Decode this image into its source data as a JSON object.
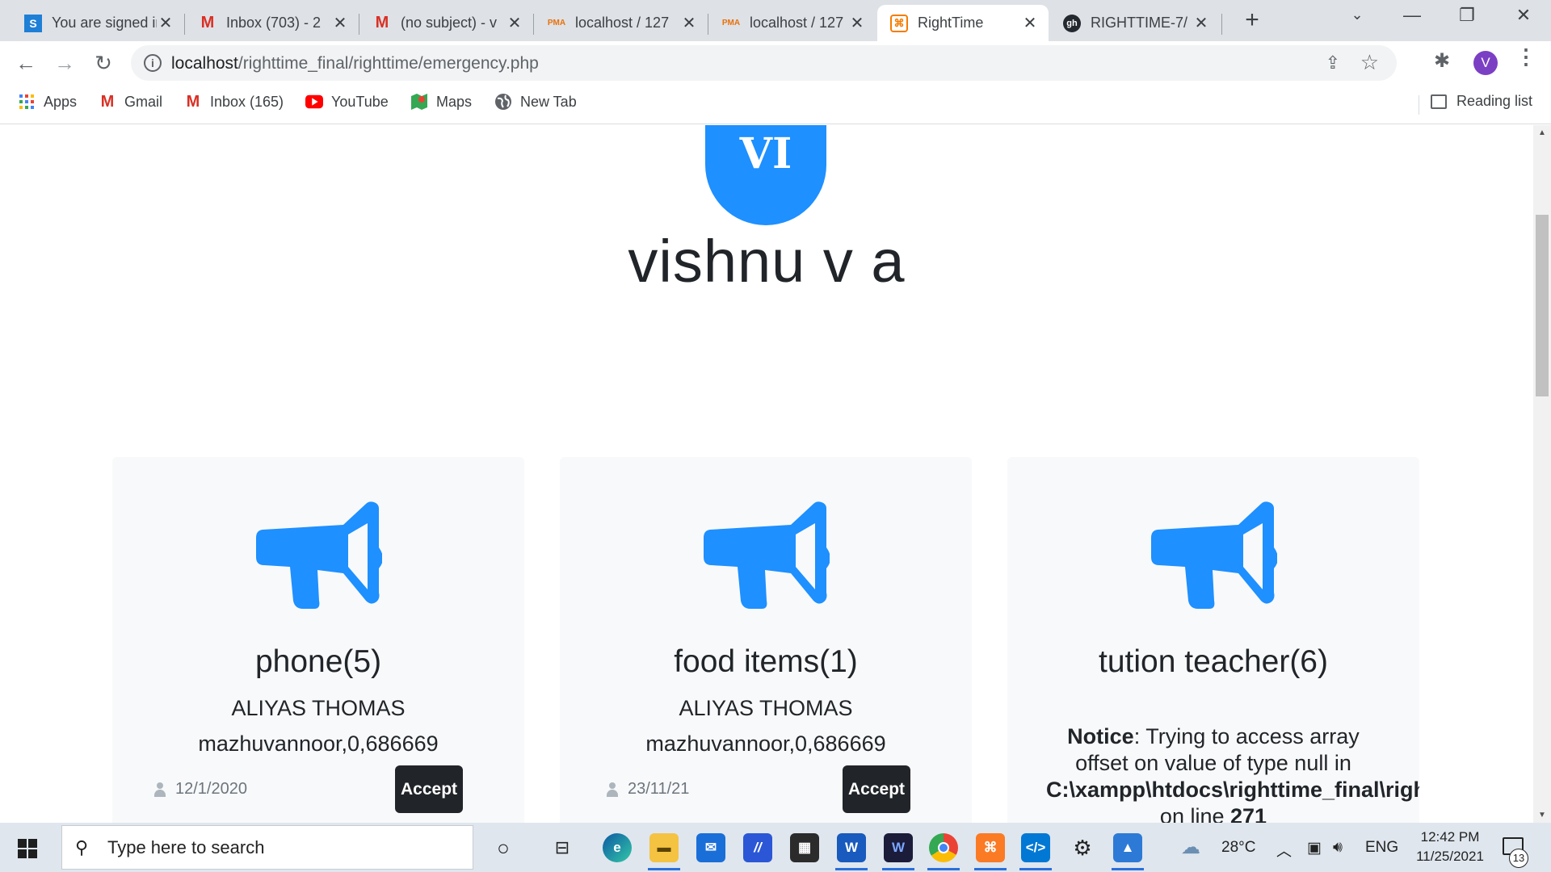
{
  "browser": {
    "tabs": [
      {
        "title": "You are signed in",
        "favicon": "S",
        "color": "#1e7fd6",
        "active": false
      },
      {
        "title": "Inbox (703) - 2",
        "favicon": "M",
        "color": "#d93025",
        "active": false
      },
      {
        "title": "(no subject) - v",
        "favicon": "M",
        "color": "#d93025",
        "active": false
      },
      {
        "title": "localhost / 127",
        "favicon": "PMA",
        "color": "#e8710a",
        "active": false
      },
      {
        "title": "localhost / 127",
        "favicon": "PMA",
        "color": "#e8710a",
        "active": false
      },
      {
        "title": "RightTime",
        "favicon": "x",
        "color": "#f57c00",
        "active": true
      },
      {
        "title": "RIGHTTIME-7/",
        "favicon": "gh",
        "color": "#24292f",
        "active": false
      }
    ],
    "url_host": "localhost",
    "url_path": "/righttime_final/righttime/emergency.php",
    "profile_initial": "V",
    "bookmarks": [
      {
        "label": "Apps",
        "icon": "apps-icon"
      },
      {
        "label": "Gmail",
        "icon": "gmail-icon"
      },
      {
        "label": "Inbox (165)",
        "icon": "gmail-icon"
      },
      {
        "label": "YouTube",
        "icon": "youtube-icon"
      },
      {
        "label": "Maps",
        "icon": "maps-icon"
      },
      {
        "label": "New Tab",
        "icon": "globe-icon"
      }
    ],
    "reading_list": "Reading list"
  },
  "profile": {
    "initials": "VI",
    "name": "vishnu v a",
    "accent": "#1e90ff"
  },
  "cards": [
    {
      "title": "phone(5)",
      "owner": "ALIYAS THOMAS",
      "address": "mazhuvannoor,0,686669",
      "date": "12/1/2020",
      "action": "Accept"
    },
    {
      "title": "food items(1)",
      "owner": "ALIYAS THOMAS",
      "address": "mazhuvannoor,0,686669",
      "date": "23/11/21",
      "action": "Accept"
    },
    {
      "title": "tution teacher(6)",
      "notice_label": "Notice",
      "notice_line1": ": Trying to access array",
      "notice_line2": "offset on value of type null in",
      "notice_path": "C:\\xampp\\htdocs\\righttime_final\\righttime\\eme",
      "notice_line_prefix": "on line ",
      "notice_line_no": "271"
    }
  ],
  "taskbar": {
    "search_placeholder": "Type here to search",
    "weather": "28°C",
    "lang": "ENG",
    "time": "12:42 PM",
    "date": "11/25/2021",
    "notifications": "13"
  }
}
